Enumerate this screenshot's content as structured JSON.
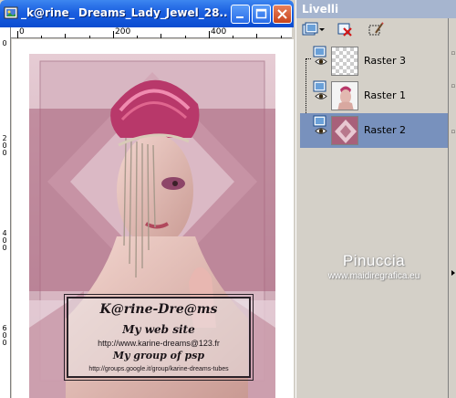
{
  "window": {
    "title": "_k@rine_ Dreams_Lady_Jewel_28...",
    "app_icon": "paint-shop-pro-icon",
    "buttons": [
      "minimize",
      "maximize",
      "close"
    ]
  },
  "rulers": {
    "horizontal_labels": [
      "0",
      "200",
      "400"
    ],
    "vertical_labels": [
      "0",
      "2 0 0",
      "4 0 0",
      "6 0 0"
    ]
  },
  "artwork": {
    "signature_title": "K@rine-Dre@ms",
    "line1": "My web site",
    "url": "http://www.karine-dreams@123.fr",
    "line3": "My group of psp",
    "groups_url": "http://groups.google.it/group/karine-dreams-tubes"
  },
  "layers_panel": {
    "title": "Livelli",
    "toolbar_icons": [
      "new-layer-icon",
      "dropdown-arrow-icon",
      "delete-layer-icon",
      "edit-layer-icon"
    ],
    "layers": [
      {
        "name": "Raster 3",
        "visible": true,
        "selected": false
      },
      {
        "name": "Raster 1",
        "visible": true,
        "selected": false
      },
      {
        "name": "Raster 2",
        "visible": true,
        "selected": true
      }
    ],
    "watermark_name": "Pinuccia",
    "watermark_site": "www.maidiregrafica.eu"
  },
  "colors": {
    "titlebar": "#1a5fe0",
    "layers_title": "#a6b5cf",
    "selected_row": "#7891bd",
    "art_pink": "#b8788c"
  }
}
